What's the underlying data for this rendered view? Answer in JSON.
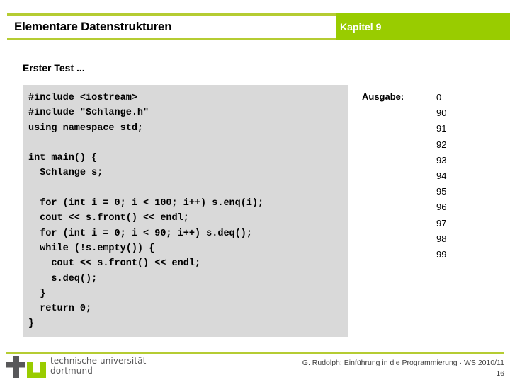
{
  "header": {
    "title": "Elementare Datenstrukturen",
    "chapter": "Kapitel 9",
    "accent_green": "#99cc00",
    "rule_green": "#b5cc32"
  },
  "section": {
    "heading": "Erster Test ..."
  },
  "code": {
    "background": "#d9d9d9",
    "lines": [
      "#include <iostream>",
      "#include \"Schlange.h\"",
      "using namespace std;",
      "",
      "int main() {",
      "  Schlange s;",
      "",
      "  for (int i = 0; i < 100; i++) s.enq(i);",
      "  cout << s.front() << endl;",
      "  for (int i = 0; i < 90; i++) s.deq();",
      "  while (!s.empty()) {",
      "    cout << s.front() << endl;",
      "    s.deq();",
      "  }",
      "  return 0;",
      "}"
    ]
  },
  "output": {
    "label": "Ausgabe:",
    "values": [
      "0",
      "90",
      "91",
      "92",
      "93",
      "94",
      "95",
      "96",
      "97",
      "98",
      "99"
    ]
  },
  "footer": {
    "logo": {
      "letter_t": "t",
      "letter_u": "u",
      "line1": "technische universität",
      "line2": "dortmund",
      "t_color": "#58585a",
      "u_color": "#99cc00"
    },
    "credit": "G. Rudolph: Einführung in die Programmierung · WS 2010/11",
    "page_number": "16"
  }
}
